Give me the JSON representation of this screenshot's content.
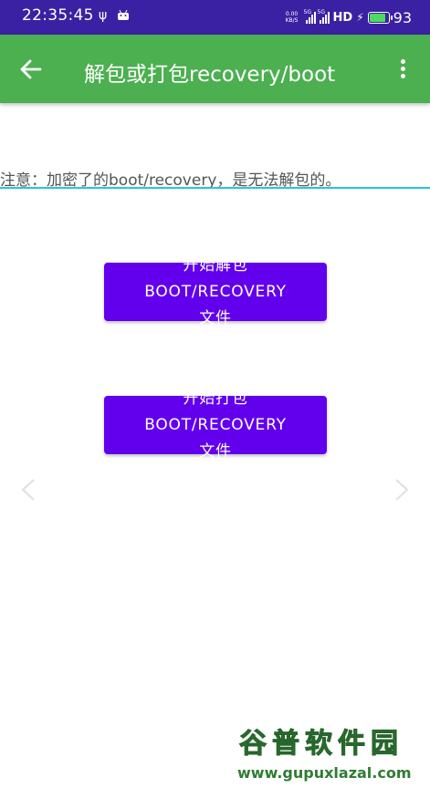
{
  "status_bar": {
    "time": "22:35:45",
    "net_speed_value": "0.00",
    "net_speed_unit": "KB/S",
    "sim1_tag": "5G",
    "sim2_tag": "5G",
    "hd_label": "HD",
    "battery_level": "93",
    "battery_fraction": 0.93
  },
  "app_bar": {
    "title": "解包或打包recovery/boot",
    "back_icon": "arrow-left-icon",
    "more_icon": "more-vert-icon",
    "color": "#4caf50"
  },
  "notice": {
    "text": "注意：加密了的boot/recovery，是无法解包的。",
    "underline_color": "#26c6da"
  },
  "buttons": {
    "unpack_label": "开始解包BOOT/RECOVERY文件",
    "pack_label": "开始打包BOOT/RECOVERY文件",
    "color": "#6200ee"
  },
  "watermark": {
    "logo": "谷普软件园",
    "url": "www.gupuxlazal.com"
  }
}
